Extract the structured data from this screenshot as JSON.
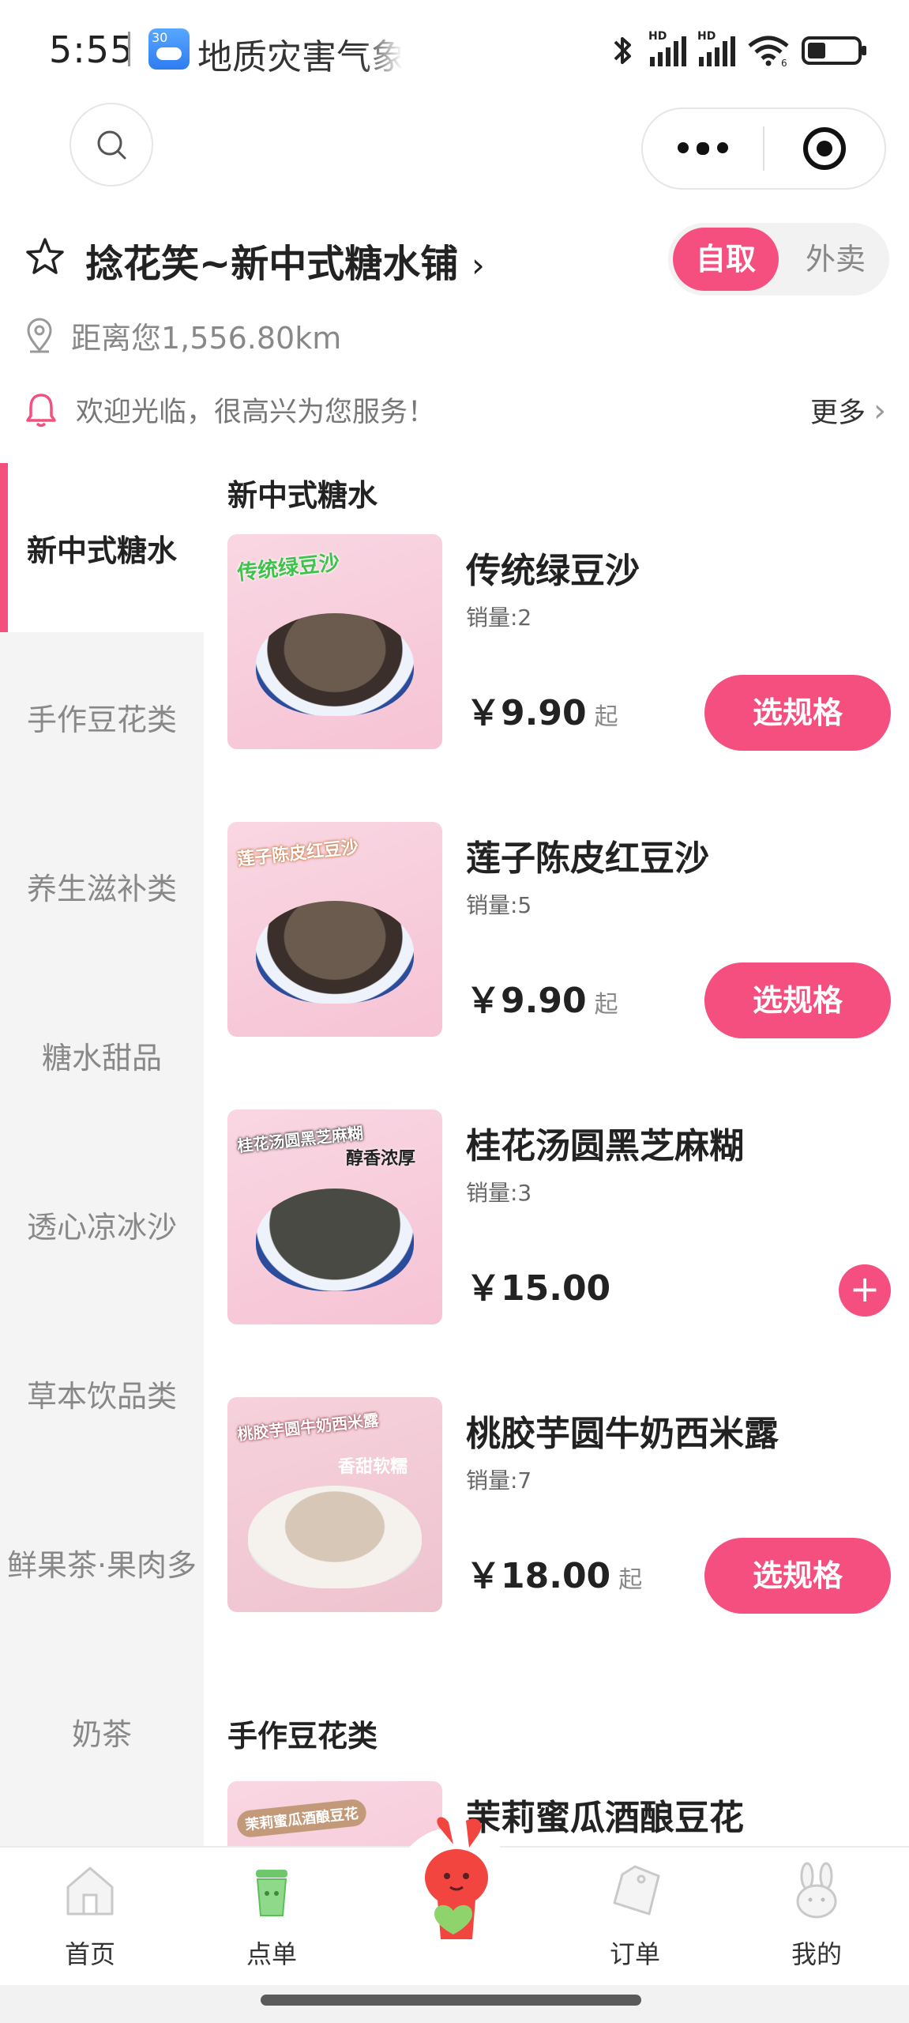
{
  "status_bar": {
    "time": "5:55",
    "app_icon_label": "30",
    "app_name": "地质灾害气象",
    "signal1_label": "HD",
    "signal2_label": "HD",
    "wifi_label": "6",
    "icons": [
      "bluetooth-icon",
      "signal-icon",
      "signal-icon",
      "wifi-icon",
      "battery-icon"
    ]
  },
  "shop": {
    "name": "捻花笑~新中式糖水铺",
    "mode_self": "自取",
    "mode_delivery": "外卖",
    "distance": "距离您1,556.80km",
    "notice": "欢迎光临，很高兴为您服务！",
    "notice_more": "更多",
    "accent_color": "#f44f7f"
  },
  "sidebar": {
    "items": [
      {
        "label": "新中式糖水",
        "active": true
      },
      {
        "label": "手作豆花类",
        "active": false
      },
      {
        "label": "养生滋补类",
        "active": false
      },
      {
        "label": "糖水甜品",
        "active": false
      },
      {
        "label": "透心凉冰沙",
        "active": false
      },
      {
        "label": "草本饮品类",
        "active": false
      },
      {
        "label": "鲜果茶·果肉多",
        "active": false
      },
      {
        "label": "奶茶",
        "active": false
      }
    ]
  },
  "menu": {
    "sections": [
      {
        "title": "新中式糖水",
        "products": [
          {
            "name": "传统绿豆沙",
            "sales": "销量:2",
            "price": "￥9.90",
            "suffix": "起",
            "action": "选规格",
            "image_text": "传统绿豆沙"
          },
          {
            "name": "莲子陈皮红豆沙",
            "sales": "销量:5",
            "price": "￥9.90",
            "suffix": "起",
            "action": "选规格",
            "image_text": "莲子陈皮红豆沙"
          },
          {
            "name": "桂花汤圆黑芝麻糊",
            "sales": "销量:3",
            "price": "￥15.00",
            "suffix": "",
            "action": "+",
            "image_text": "桂花汤圆黑芝麻糊",
            "image_text2": "醇香浓厚"
          },
          {
            "name": "桃胶芋圆牛奶西米露",
            "sales": "销量:7",
            "price": "￥18.00",
            "suffix": "起",
            "action": "选规格",
            "image_text": "桃胶芋圆牛奶西米露",
            "image_text2": "香甜软糯"
          }
        ]
      },
      {
        "title": "手作豆花类",
        "products": [
          {
            "name": "茉莉蜜瓜酒酿豆花",
            "image_text": "茉莉蜜瓜酒酿豆花"
          }
        ]
      }
    ]
  },
  "tabbar": {
    "items": [
      {
        "label": "首页",
        "icon": "house-icon"
      },
      {
        "label": "点单",
        "icon": "cup-icon"
      },
      {
        "label": "",
        "icon": "mascot-icon"
      },
      {
        "label": "订单",
        "icon": "tag-icon"
      },
      {
        "label": "我的",
        "icon": "rabbit-icon"
      }
    ]
  }
}
